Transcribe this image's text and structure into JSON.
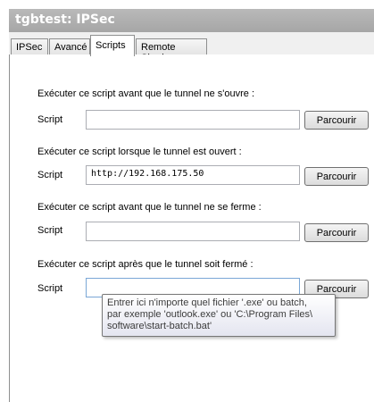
{
  "window": {
    "title": "tgbtest: IPSec"
  },
  "tabs": [
    {
      "label": "IPSec"
    },
    {
      "label": "Avancé"
    },
    {
      "label": "Scripts"
    },
    {
      "label": "Remote Sharing"
    }
  ],
  "active_tab": "Scripts",
  "scripts": [
    {
      "section_label": "Exécuter ce script avant que le tunnel ne s'ouvre :",
      "field_label": "Script",
      "value": "",
      "button_label": "Parcourir"
    },
    {
      "section_label": "Exécuter ce script lorsque le tunnel est ouvert :",
      "field_label": "Script",
      "value": "http://192.168.175.50",
      "button_label": "Parcourir"
    },
    {
      "section_label": "Exécuter ce script avant que le tunnel ne se ferme :",
      "field_label": "Script",
      "value": "",
      "button_label": "Parcourir"
    },
    {
      "section_label": "Exécuter ce script après que le tunnel soit fermé :",
      "field_label": "Script",
      "value": "",
      "button_label": "Parcourir"
    }
  ],
  "tooltip": {
    "lines": [
      "Entrer ici n'importe quel fichier '.exe' ou batch,",
      "par exemple 'outlook.exe' ou 'C:\\Program Files\\",
      "software\\start-batch.bat'"
    ]
  }
}
